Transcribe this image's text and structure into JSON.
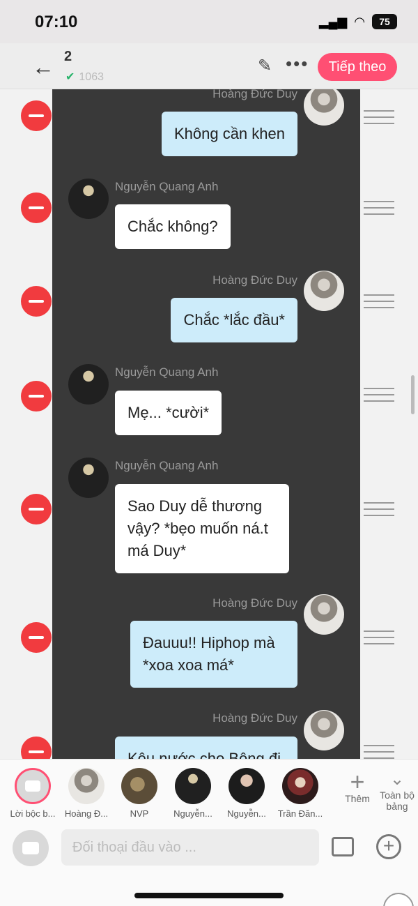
{
  "status_bar": {
    "time": "07:10",
    "battery": "75"
  },
  "top_bar": {
    "count": "2",
    "word_count": "1063",
    "next_label": "Tiếp theo"
  },
  "messages": [
    {
      "sender": "Hoàng Đức Duy",
      "text": "Không cần khen"
    },
    {
      "sender": "Nguyễn Quang Anh",
      "text": "Chắc không?"
    },
    {
      "sender": "Hoàng Đức Duy",
      "text": "Chắc *lắc đầu*"
    },
    {
      "sender": "Nguyễn Quang Anh",
      "text": "Mẹ... *cười*"
    },
    {
      "sender": "Nguyễn Quang Anh",
      "text": "Sao Duy dễ thương vậy? *bẹo muốn ná.t má Duy*"
    },
    {
      "sender": "Hoàng Đức Duy",
      "text": "Đauuu!! Hiphop mà *xoa xoa má*"
    },
    {
      "sender": "Hoàng Đức Duy",
      "text": "Kêu nước cho Bông đi"
    }
  ],
  "characters": [
    {
      "label": "Lời bộc b..."
    },
    {
      "label": "Hoàng Đ..."
    },
    {
      "label": "NVP"
    },
    {
      "label": "Nguyễn..."
    },
    {
      "label": "Nguyễn..."
    },
    {
      "label": "Trần Đăn..."
    }
  ],
  "add_character_label": "Thêm",
  "all_board_label": "Toàn bộ bảng",
  "input": {
    "placeholder": "Đối thoại đầu vào ..."
  }
}
